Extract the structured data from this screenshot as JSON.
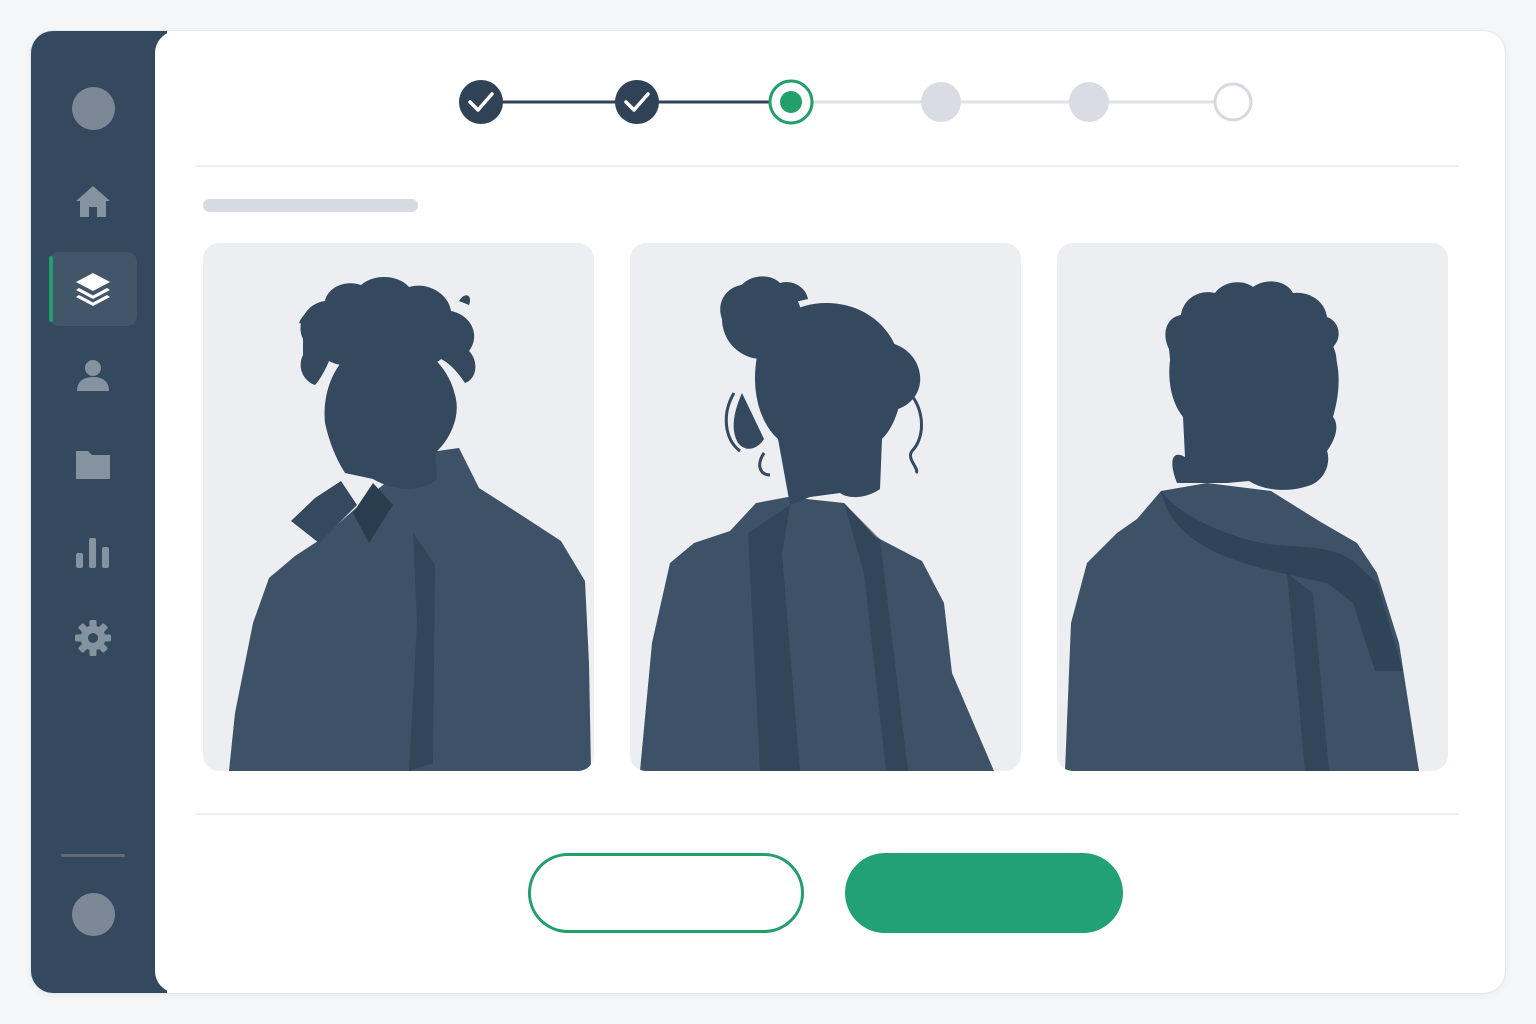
{
  "colors": {
    "sidebar": "#34495e",
    "accent": "#22a06b",
    "primary_button": "#22a076",
    "step_complete": "#2f4256",
    "step_pending": "#d9dde3",
    "silhouette": "#34495e",
    "card_bg": "#eceef2"
  },
  "sidebar": {
    "items": [
      {
        "icon": "home-icon",
        "active": false
      },
      {
        "icon": "layers-icon",
        "active": true
      },
      {
        "icon": "user-icon",
        "active": false
      },
      {
        "icon": "folder-icon",
        "active": false
      },
      {
        "icon": "bar-chart-icon",
        "active": false
      },
      {
        "icon": "gear-icon",
        "active": false
      }
    ]
  },
  "stepper": {
    "total_steps": 6,
    "current_step": 3,
    "steps": [
      {
        "state": "complete"
      },
      {
        "state": "complete"
      },
      {
        "state": "current"
      },
      {
        "state": "pending"
      },
      {
        "state": "pending"
      },
      {
        "state": "empty"
      }
    ]
  },
  "cards": [
    {
      "icon": "person-silhouette-short-hair-icon"
    },
    {
      "icon": "person-silhouette-hair-bun-icon"
    },
    {
      "icon": "person-silhouette-curly-hair-beard-icon"
    }
  ],
  "actions": {
    "secondary_label": "",
    "primary_label": ""
  }
}
